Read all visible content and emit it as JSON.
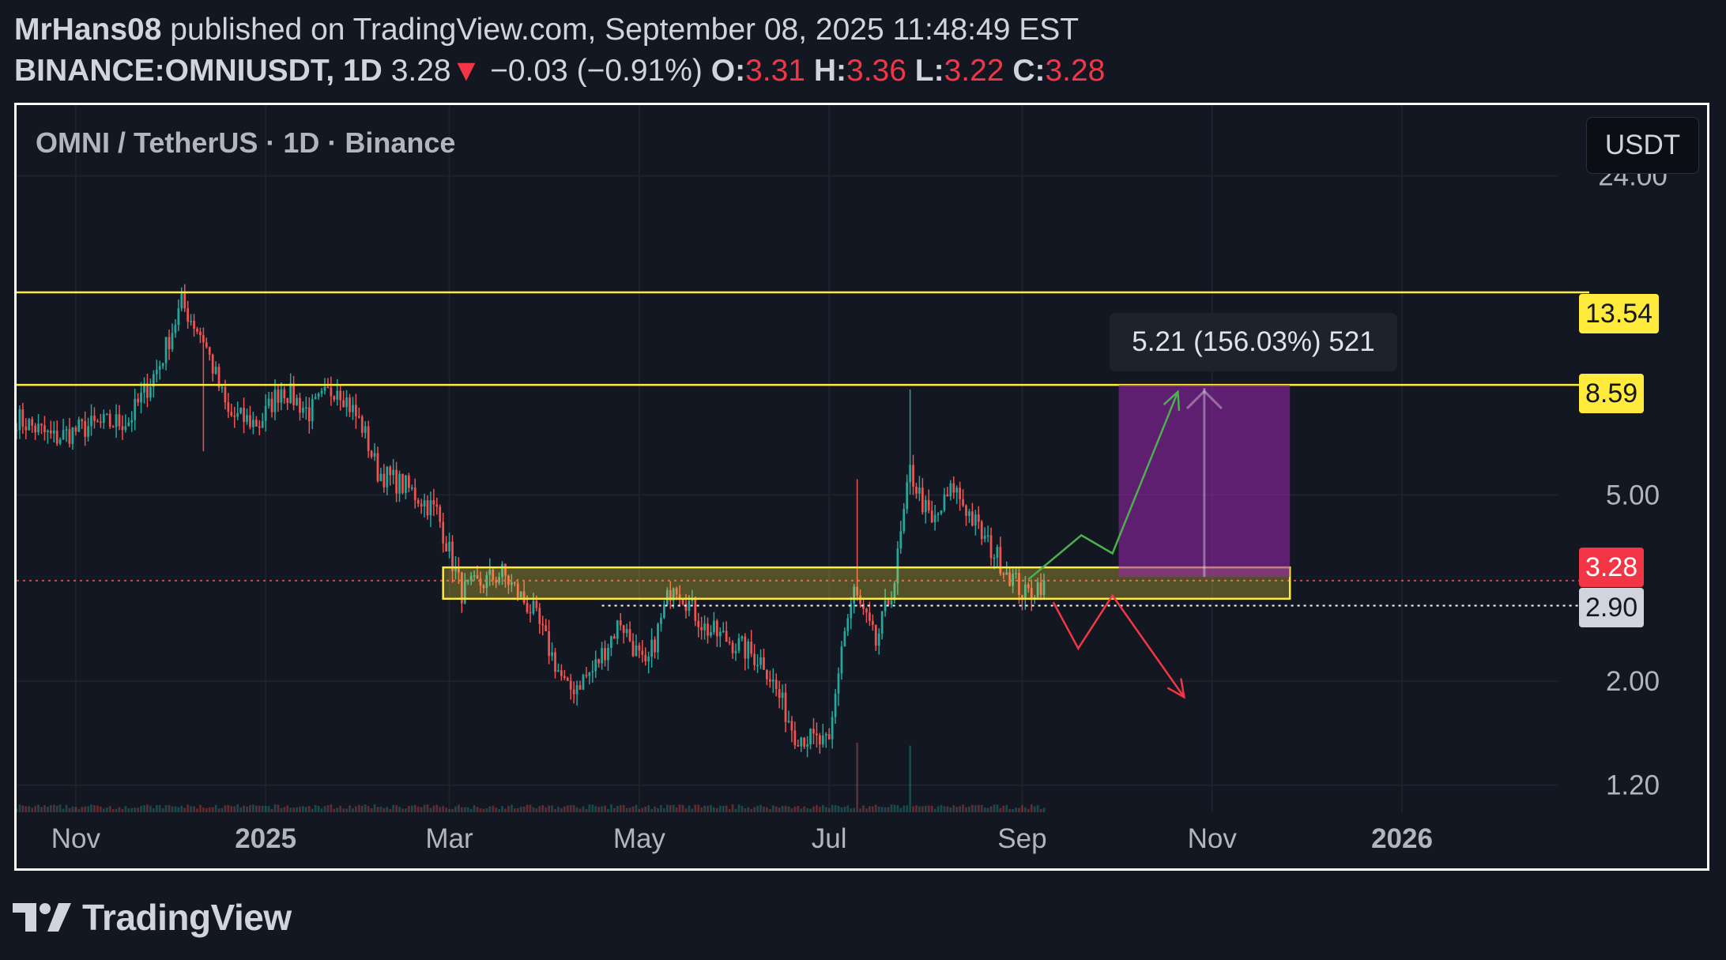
{
  "header": {
    "author": "MrHans08",
    "published_text": "published on TradingView.com, September 08, 2025 11:48:49 EST",
    "symbol": "BINANCE:OMNIUSDT, 1D",
    "last": "3.28",
    "change_arrow": "▼",
    "change": "−0.03 (−0.91%)",
    "o_label": "O:",
    "o": "3.31",
    "h_label": "H:",
    "h": "3.36",
    "l_label": "L:",
    "l": "3.22",
    "c_label": "C:",
    "c": "3.28"
  },
  "chart_title": "OMNI / TetherUS · 1D · Binance",
  "currency_button": "USDT",
  "price_tags": {
    "level_high": "13.54",
    "level_mid": "8.59",
    "current": "3.28",
    "support": "2.90"
  },
  "measure_label": "5.21 (156.03%) 521",
  "brand": "TradingView",
  "colors": {
    "background": "#131722",
    "up": "#26a69a",
    "down": "#ef5350",
    "level_line": "#ffeb3b",
    "current_tag": "#f23645",
    "measure_fill": "#9c27b0",
    "green_arrow": "#4caf50",
    "red_arrow": "#f23645"
  },
  "chart_data": {
    "type": "candlestick",
    "y_scale": "log",
    "y_ticks": [
      24,
      5,
      2,
      1.2
    ],
    "y_tick_labels": [
      "24.00",
      "5.00",
      "2.00",
      "1.20"
    ],
    "x_tick_labels": [
      "Nov",
      "2025",
      "Mar",
      "May",
      "Jul",
      "Sep",
      "Nov",
      "2026"
    ],
    "x_tick_dates": [
      "2024-11-01",
      "2025-01-01",
      "2025-03-01",
      "2025-05-01",
      "2025-07-01",
      "2025-09-01",
      "2025-11-01",
      "2026-01-01"
    ],
    "date_range": [
      "2024-10-13",
      "2026-02-20"
    ],
    "ylim": [
      1.05,
      34
    ],
    "horizontal_levels": [
      13.54,
      8.59
    ],
    "current_price": 3.28,
    "support_line": 2.9,
    "zone": {
      "from": "2025-02-27",
      "to": "2025-11-26",
      "low": 3.0,
      "high": 3.5
    },
    "target_box": {
      "from": "2025-10-02",
      "to": "2025-11-26",
      "low": 3.34,
      "high": 8.59
    },
    "scenario_up": [
      [
        "2025-09-03",
        3.3
      ],
      [
        "2025-09-20",
        4.1
      ],
      [
        "2025-09-30",
        3.75
      ],
      [
        "2025-10-21",
        8.3
      ]
    ],
    "scenario_down": [
      [
        "2025-09-11",
        2.95
      ],
      [
        "2025-09-19",
        2.35
      ],
      [
        "2025-09-30",
        3.05
      ],
      [
        "2025-10-23",
        1.85
      ]
    ],
    "candle_anchors": [
      [
        "2024-10-13",
        7.3
      ],
      [
        "2024-10-25",
        6.6
      ],
      [
        "2024-11-05",
        7.0
      ],
      [
        "2024-11-18",
        7.2
      ],
      [
        "2024-11-28",
        9.5
      ],
      [
        "2024-12-05",
        12.8
      ],
      [
        "2024-12-12",
        10.8
      ],
      [
        "2024-12-20",
        7.4
      ],
      [
        "2024-12-30",
        7.1
      ],
      [
        "2025-01-06",
        8.5
      ],
      [
        "2025-01-15",
        7.5
      ],
      [
        "2025-01-24",
        8.6
      ],
      [
        "2025-02-01",
        7.0
      ],
      [
        "2025-02-06",
        5.6
      ],
      [
        "2025-02-15",
        5.2
      ],
      [
        "2025-02-25",
        4.6
      ],
      [
        "2025-03-05",
        3.1
      ],
      [
        "2025-03-18",
        3.4
      ],
      [
        "2025-03-28",
        2.8
      ],
      [
        "2025-04-08",
        1.9
      ],
      [
        "2025-04-16",
        2.1
      ],
      [
        "2025-04-25",
        2.7
      ],
      [
        "2025-05-03",
        2.1
      ],
      [
        "2025-05-12",
        3.3
      ],
      [
        "2025-05-22",
        2.6
      ],
      [
        "2025-06-01",
        2.4
      ],
      [
        "2025-06-10",
        2.2
      ],
      [
        "2025-06-20",
        1.55
      ],
      [
        "2025-07-01",
        1.45
      ],
      [
        "2025-07-05",
        2.4
      ],
      [
        "2025-07-09",
        3.1
      ],
      [
        "2025-07-16",
        2.4
      ],
      [
        "2025-07-22",
        3.3
      ],
      [
        "2025-07-27",
        5.6
      ],
      [
        "2025-08-03",
        4.3
      ],
      [
        "2025-08-10",
        5.2
      ],
      [
        "2025-08-20",
        4.0
      ],
      [
        "2025-09-02",
        3.05
      ],
      [
        "2025-09-08",
        3.28
      ]
    ]
  }
}
